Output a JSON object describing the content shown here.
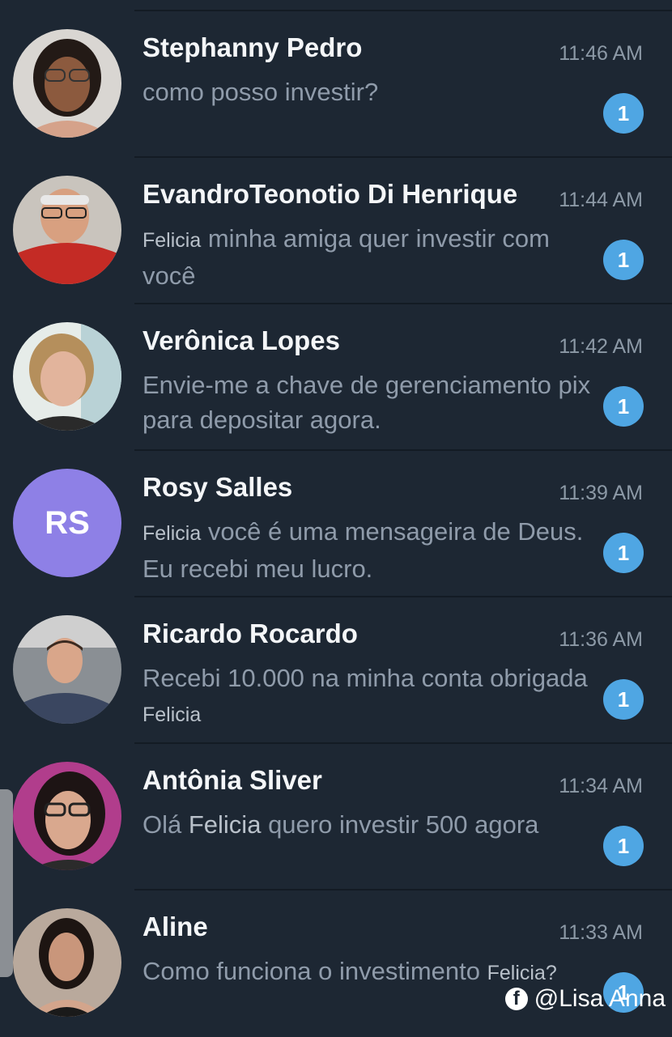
{
  "chats": [
    {
      "name": "Stephanny Pedro",
      "time": "11:46 AM",
      "tag": "",
      "message": "como posso investir?",
      "tag_after": "",
      "unread": "1"
    },
    {
      "name": "EvandroTeonotio Di Henrique",
      "time": "11:44 AM",
      "tag": "Felicia",
      "message": " minha amiga quer investir com você",
      "tag_after": "",
      "unread": "1"
    },
    {
      "name": "Verônica Lopes",
      "time": "11:42 AM",
      "tag": "",
      "message": "Envie-me a chave de gerenciamento pix para depositar agora.",
      "tag_after": "",
      "unread": "1"
    },
    {
      "name": "Rosy Salles",
      "initials": "RS",
      "time": "11:39 AM",
      "tag": "Felicia",
      "message": " você é uma mensageira de Deus. Eu recebi meu lucro.",
      "tag_after": "",
      "unread": "1"
    },
    {
      "name": "Ricardo Rocardo",
      "time": "11:36 AM",
      "tag": "",
      "message": "Recebi 10.000 na minha conta obrigada ",
      "tag_after": "Felicia",
      "unread": "1"
    },
    {
      "name": "Antônia Sliver",
      "time": "11:34 AM",
      "tag": "",
      "message": "Olá ",
      "tag_mid": "Felicia",
      "message_end": " quero investir 500 agora",
      "unread": "1"
    },
    {
      "name": "Aline",
      "time": "11:33 AM",
      "tag": "",
      "message": "Como funciona o investimento ",
      "tag_after": "Felicia?",
      "unread": "1"
    }
  ],
  "watermark": {
    "icon": "facebook-icon",
    "text": "@Lisa Anna"
  },
  "colors": {
    "background": "#1d2733",
    "badge": "#4fa6e3",
    "initials_avatar": "#8e80e6"
  }
}
